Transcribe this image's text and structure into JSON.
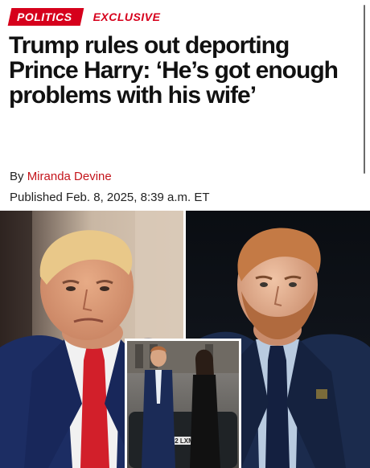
{
  "article": {
    "tags": {
      "section": "POLITICS",
      "label": "EXCLUSIVE"
    },
    "headline": "Trump rules out deporting Prince Harry: ‘He’s got enough problems with his wife’",
    "byline": {
      "prefix": "By",
      "author": "Miranda Devine"
    },
    "published": "Published Feb. 8, 2025, 8:39 a.m. ET",
    "photo": {
      "plate_text": "2 LXM",
      "subjects": [
        "Donald Trump",
        "Prince Harry",
        "Prince Harry and Meghan Markle"
      ]
    }
  },
  "colors": {
    "accent": "#d6001c",
    "author_link": "#c4151c",
    "headline": "#111111",
    "trump_tie": "#d21f2a",
    "navy_suit": "#1b2b4d"
  }
}
